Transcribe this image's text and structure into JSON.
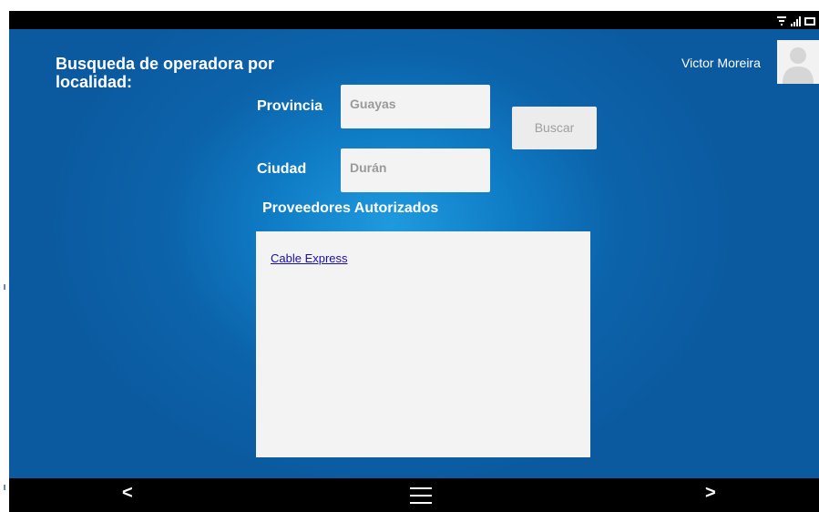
{
  "page": {
    "title": "Busqueda de operadora por localidad:",
    "user_name": "Victor Moreira"
  },
  "search_form": {
    "provincia_label": "Provincia",
    "provincia_value": "Guayas",
    "ciudad_label": "Ciudad",
    "ciudad_value": "Durán",
    "search_button_label": "Buscar"
  },
  "results": {
    "heading": "Proveedores Autorizados",
    "items": [
      {
        "label": "Cable Express"
      }
    ]
  },
  "nav_bar": {
    "back_label": "<",
    "forward_label": ">"
  },
  "icons": {
    "status": [
      "wifi-icon",
      "signal-icon",
      "battery-icon"
    ],
    "avatar": "user-avatar-icon",
    "menu": "menu-icon"
  },
  "colors": {
    "background": "#0b63aa",
    "background_center": "#1f9ade",
    "field_background": "#f3f3f3",
    "link": "#1a0dab"
  }
}
